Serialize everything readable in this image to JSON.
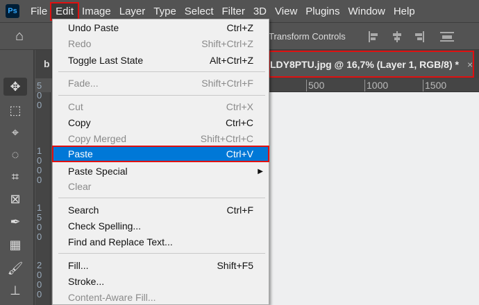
{
  "menubar": {
    "items": [
      "File",
      "Edit",
      "Image",
      "Layer",
      "Type",
      "Select",
      "Filter",
      "3D",
      "View",
      "Plugins",
      "Window",
      "Help"
    ],
    "active": "Edit",
    "logo": "Ps"
  },
  "options_bar": {
    "label": "Transform Controls"
  },
  "document": {
    "left_tab_partial": "b",
    "active_tab": "LDY8PTU.jpg @ 16,7% (Layer 1, RGB/8) *",
    "close": "×"
  },
  "rulers": {
    "horizontal": [
      "500",
      "1000",
      "1500"
    ],
    "vertical": [
      "500",
      "1000",
      "1500",
      "2000"
    ]
  },
  "edit_menu": {
    "items": [
      {
        "label": "Undo Paste",
        "shortcut": "Ctrl+Z",
        "enabled": true
      },
      {
        "label": "Redo",
        "shortcut": "Shift+Ctrl+Z",
        "enabled": false
      },
      {
        "label": "Toggle Last State",
        "shortcut": "Alt+Ctrl+Z",
        "enabled": true
      },
      {
        "label": "Fade...",
        "shortcut": "Shift+Ctrl+F",
        "enabled": false
      },
      {
        "label": "Cut",
        "shortcut": "Ctrl+X",
        "enabled": false
      },
      {
        "label": "Copy",
        "shortcut": "Ctrl+C",
        "enabled": true
      },
      {
        "label": "Copy Merged",
        "shortcut": "Shift+Ctrl+C",
        "enabled": false
      },
      {
        "label": "Paste",
        "shortcut": "Ctrl+V",
        "enabled": true,
        "highlighted": true
      },
      {
        "label": "Paste Special",
        "shortcut": "",
        "enabled": true,
        "submenu": true
      },
      {
        "label": "Clear",
        "shortcut": "",
        "enabled": false
      },
      {
        "label": "Search",
        "shortcut": "Ctrl+F",
        "enabled": true
      },
      {
        "label": "Check Spelling...",
        "shortcut": "",
        "enabled": true
      },
      {
        "label": "Find and Replace Text...",
        "shortcut": "",
        "enabled": true
      },
      {
        "label": "Fill...",
        "shortcut": "Shift+F5",
        "enabled": true
      },
      {
        "label": "Stroke...",
        "shortcut": "",
        "enabled": true
      },
      {
        "label": "Content-Aware Fill...",
        "shortcut": "",
        "enabled": false
      }
    ]
  },
  "colors": {
    "highlight": "#0078d7",
    "annotation": "#e01010",
    "ui_bg": "#535353"
  }
}
